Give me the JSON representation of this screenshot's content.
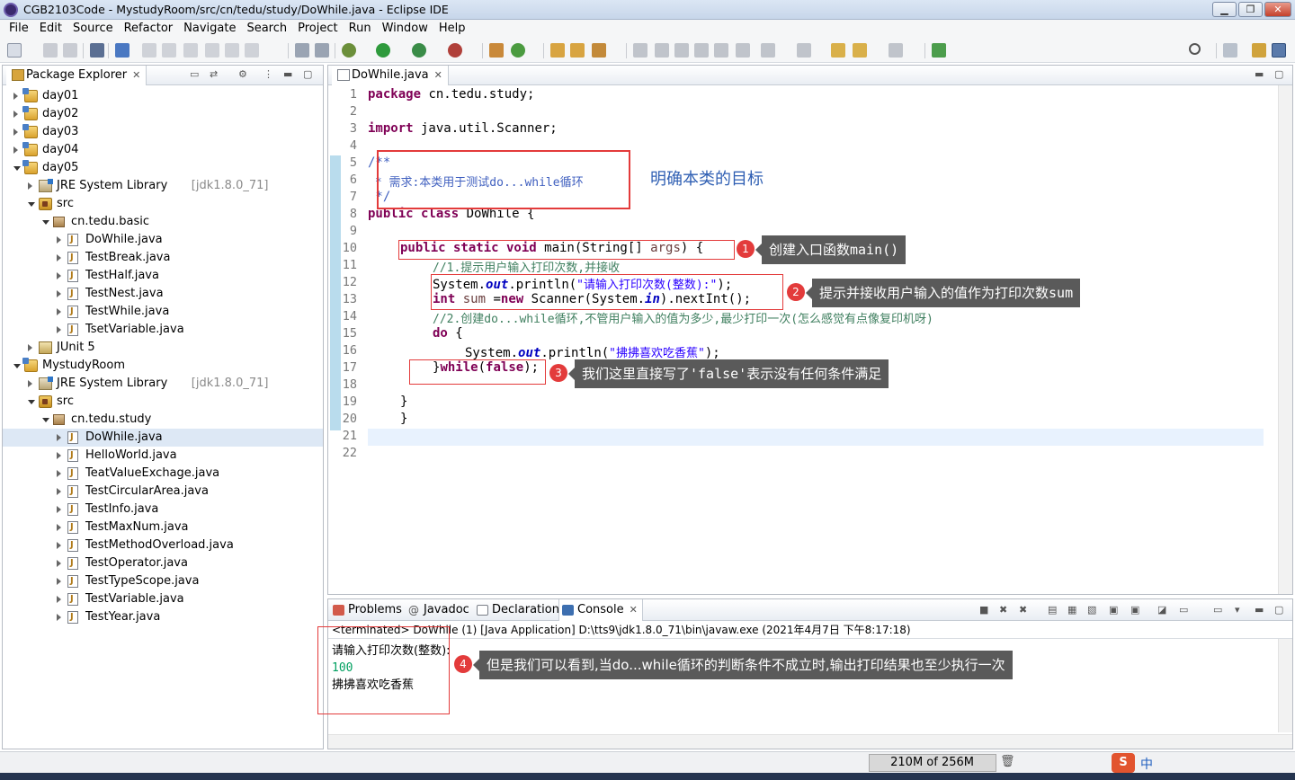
{
  "window": {
    "title": "CGB2103Code - MystudyRoom/src/cn/tedu/study/DoWhile.java - Eclipse IDE"
  },
  "menu": [
    "File",
    "Edit",
    "Source",
    "Refactor",
    "Navigate",
    "Search",
    "Project",
    "Run",
    "Window",
    "Help"
  ],
  "package_explorer": {
    "title": "Package Explorer",
    "rows": [
      {
        "label": "day01",
        "kind": "proj",
        "indent": 0,
        "open": false
      },
      {
        "label": "day02",
        "kind": "proj",
        "indent": 0,
        "open": false
      },
      {
        "label": "day03",
        "kind": "proj",
        "indent": 0,
        "open": false
      },
      {
        "label": "day04",
        "kind": "proj",
        "indent": 0,
        "open": false
      },
      {
        "label": "day05",
        "kind": "proj",
        "indent": 0,
        "open": true
      },
      {
        "label": "JRE System Library",
        "suffix": "[jdk1.8.0_71]",
        "kind": "lib",
        "indent": 1,
        "open": false
      },
      {
        "label": "src",
        "kind": "src",
        "indent": 1,
        "open": true
      },
      {
        "label": "cn.tedu.basic",
        "kind": "pkg",
        "indent": 2,
        "open": true
      },
      {
        "label": "DoWhile.java",
        "kind": "java",
        "indent": 3,
        "open": false
      },
      {
        "label": "TestBreak.java",
        "kind": "java",
        "indent": 3,
        "open": false
      },
      {
        "label": "TestHalf.java",
        "kind": "java",
        "indent": 3,
        "open": false
      },
      {
        "label": "TestNest.java",
        "kind": "java",
        "indent": 3,
        "open": false
      },
      {
        "label": "TestWhile.java",
        "kind": "java",
        "indent": 3,
        "open": false
      },
      {
        "label": "TsetVariable.java",
        "kind": "java",
        "indent": 3,
        "open": false
      },
      {
        "label": "JUnit 5",
        "kind": "junit",
        "indent": 1,
        "open": false
      },
      {
        "label": "MystudyRoom",
        "kind": "proj",
        "indent": 0,
        "open": true
      },
      {
        "label": "JRE System Library",
        "suffix": "[jdk1.8.0_71]",
        "kind": "lib",
        "indent": 1,
        "open": false
      },
      {
        "label": "src",
        "kind": "src",
        "indent": 1,
        "open": true
      },
      {
        "label": "cn.tedu.study",
        "kind": "pkg",
        "indent": 2,
        "open": true
      },
      {
        "label": "DoWhile.java",
        "kind": "java",
        "indent": 3,
        "open": false,
        "selected": true
      },
      {
        "label": "HelloWorld.java",
        "kind": "java",
        "indent": 3,
        "open": false
      },
      {
        "label": "TeatValueExchage.java",
        "kind": "java",
        "indent": 3,
        "open": false
      },
      {
        "label": "TestCircularArea.java",
        "kind": "java",
        "indent": 3,
        "open": false
      },
      {
        "label": "TestInfo.java",
        "kind": "java",
        "indent": 3,
        "open": false
      },
      {
        "label": "TestMaxNum.java",
        "kind": "java",
        "indent": 3,
        "open": false
      },
      {
        "label": "TestMethodOverload.java",
        "kind": "java",
        "indent": 3,
        "open": false
      },
      {
        "label": "TestOperator.java",
        "kind": "java",
        "indent": 3,
        "open": false
      },
      {
        "label": "TestTypeScope.java",
        "kind": "java",
        "indent": 3,
        "open": false
      },
      {
        "label": "TestVariable.java",
        "kind": "java",
        "indent": 3,
        "open": false
      },
      {
        "label": "TestYear.java",
        "kind": "java",
        "indent": 3,
        "open": false
      }
    ]
  },
  "editor": {
    "tab": "DoWhile.java",
    "line_numbers": [
      "1",
      "2",
      "3",
      "4",
      "5",
      "6",
      "7",
      "8",
      "9",
      "10",
      "11",
      "12",
      "13",
      "14",
      "15",
      "16",
      "17",
      "18",
      "19",
      "20",
      "21",
      "22"
    ],
    "code": {
      "l1_kw": "package",
      "l1_rest": " cn.tedu.study;",
      "l3_kw": "import",
      "l3_rest": " java.util.Scanner;",
      "l5": "/**",
      "l6": " * 需求:本类用于测试do...while循环",
      "l7": " */",
      "l8_kw": "public class",
      "l8_rest": " DoWhile {",
      "l10_kw": "public static void",
      "l10_rest": " main(String[] ",
      "l10_var": "args",
      "l10_end": ") {",
      "l11": "//1.提示用户输入打印次数,并接收",
      "l12_a": "System.",
      "l12_f": "out",
      "l12_b": ".println(",
      "l12_s": "\"请输入打印次数(整数):\"",
      "l12_c": ");",
      "l13_kw": "int",
      "l13_v": " sum ",
      "l13_b": "=",
      "l13_kw2": "new",
      "l13_c": " Scanner(System.",
      "l13_f": "in",
      "l13_d": ").nextInt();",
      "l14": "//2.创建do...while循环,不管用户输入的值为多少,最少打印一次(怎么感觉有点像复印机呀)",
      "l15_kw": "do",
      "l15_rest": " {",
      "l16_a": "System.",
      "l16_f": "out",
      "l16_b": ".println(",
      "l16_s": "\"拂拂喜欢吃香蕉\"",
      "l16_c": ");",
      "l17_a": "}",
      "l17_kw": "while",
      "l17_b": "(",
      "l17_kw2": "false",
      "l17_c": ");",
      "l19": "}",
      "l20": "}"
    },
    "annotations": {
      "goal": "明确本类的目标",
      "a1": "创建入口函数main()",
      "a2": "提示并接收用户输入的值作为打印次数sum",
      "a3": "我们这里直接写了'false'表示没有任何条件满足",
      "n1": "1",
      "n2": "2",
      "n3": "3"
    }
  },
  "bottom": {
    "tabs": [
      "Problems",
      "Javadoc",
      "Declaration",
      "Console"
    ],
    "console_header": "<terminated> DoWhile (1) [Java Application] D:\\tts9\\jdk1.8.0_71\\bin\\javaw.exe (2021年4月7日 下午8:17:18)",
    "output": [
      "请输入打印次数(整数):",
      "100",
      "拂拂喜欢吃香蕉"
    ],
    "annotation": "但是我们可以看到,当do...while循环的判断条件不成立时,输出打印结果也至少执行一次",
    "n4": "4"
  },
  "status": {
    "heap": "210M of 256M",
    "ime": "中"
  }
}
